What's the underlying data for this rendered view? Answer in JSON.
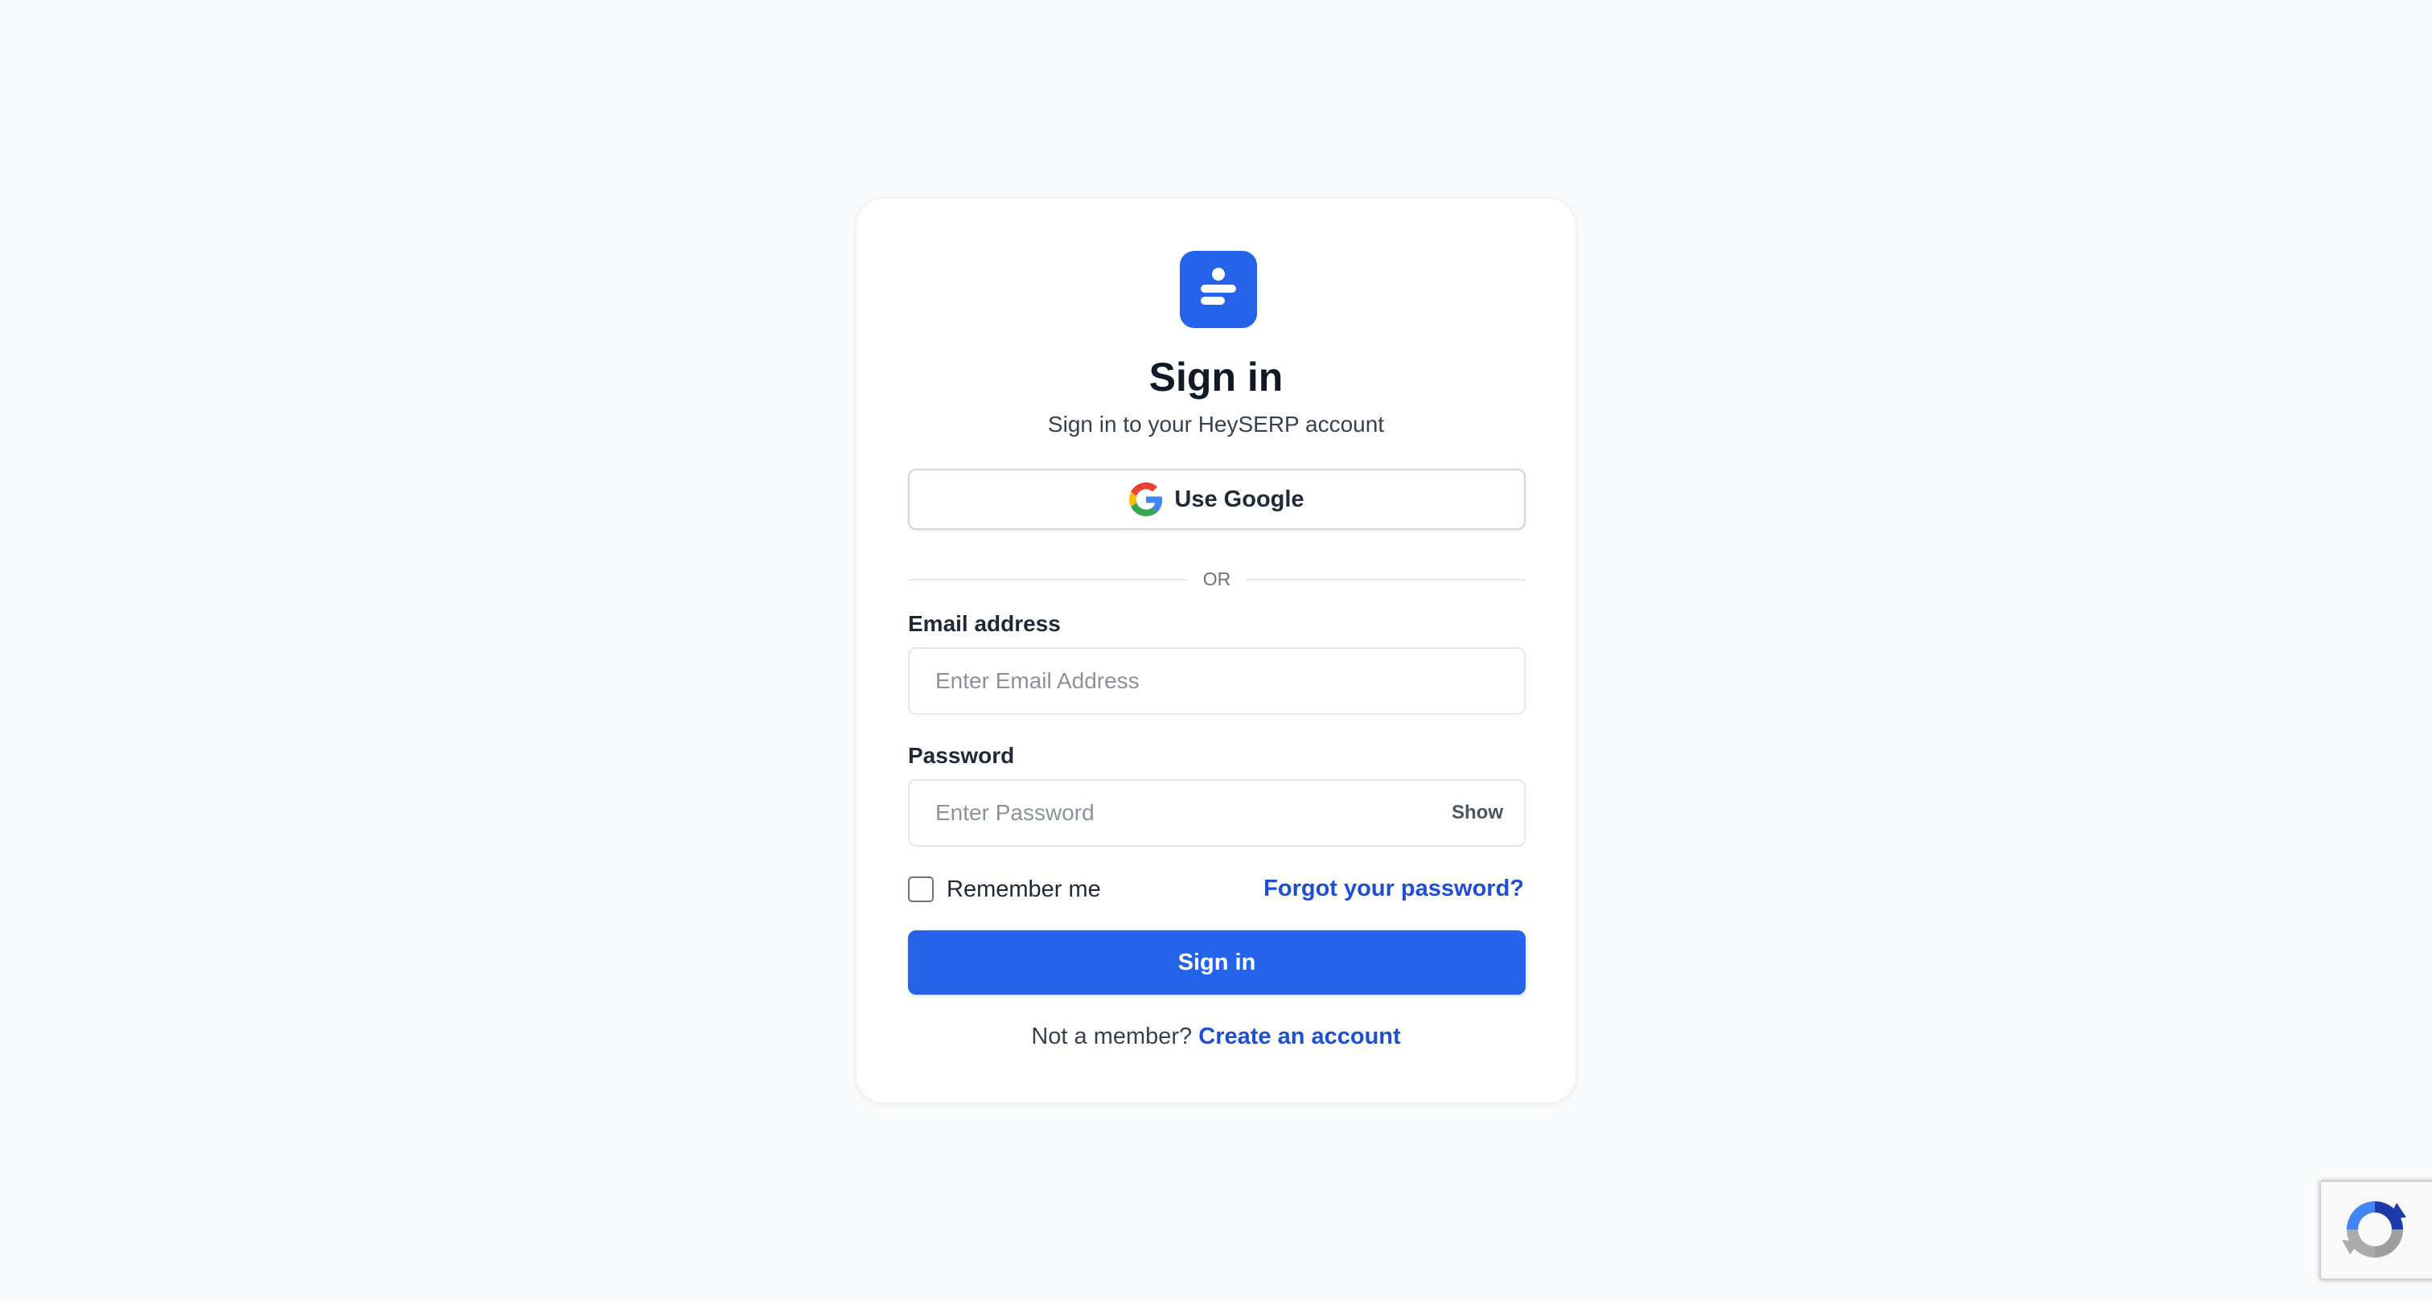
{
  "brand": {
    "accent_color": "#2563eb",
    "logo_icon": "heyserp-logo-icon"
  },
  "header": {
    "title": "Sign in",
    "subtitle": "Sign in to your HeySERP account"
  },
  "google": {
    "icon": "google-icon",
    "label": "Use Google"
  },
  "divider": {
    "text": "OR"
  },
  "email": {
    "label": "Email address",
    "placeholder": "Enter Email Address",
    "value": ""
  },
  "password": {
    "label": "Password",
    "placeholder": "Enter Password",
    "value": "",
    "toggle_label": "Show"
  },
  "remember": {
    "label": "Remember me",
    "checked": false
  },
  "forgot": {
    "label": "Forgot your password?"
  },
  "submit": {
    "label": "Sign in"
  },
  "footer": {
    "prompt": "Not a member?",
    "link_label": "Create an account"
  },
  "recaptcha": {
    "icon": "recaptcha-icon"
  }
}
